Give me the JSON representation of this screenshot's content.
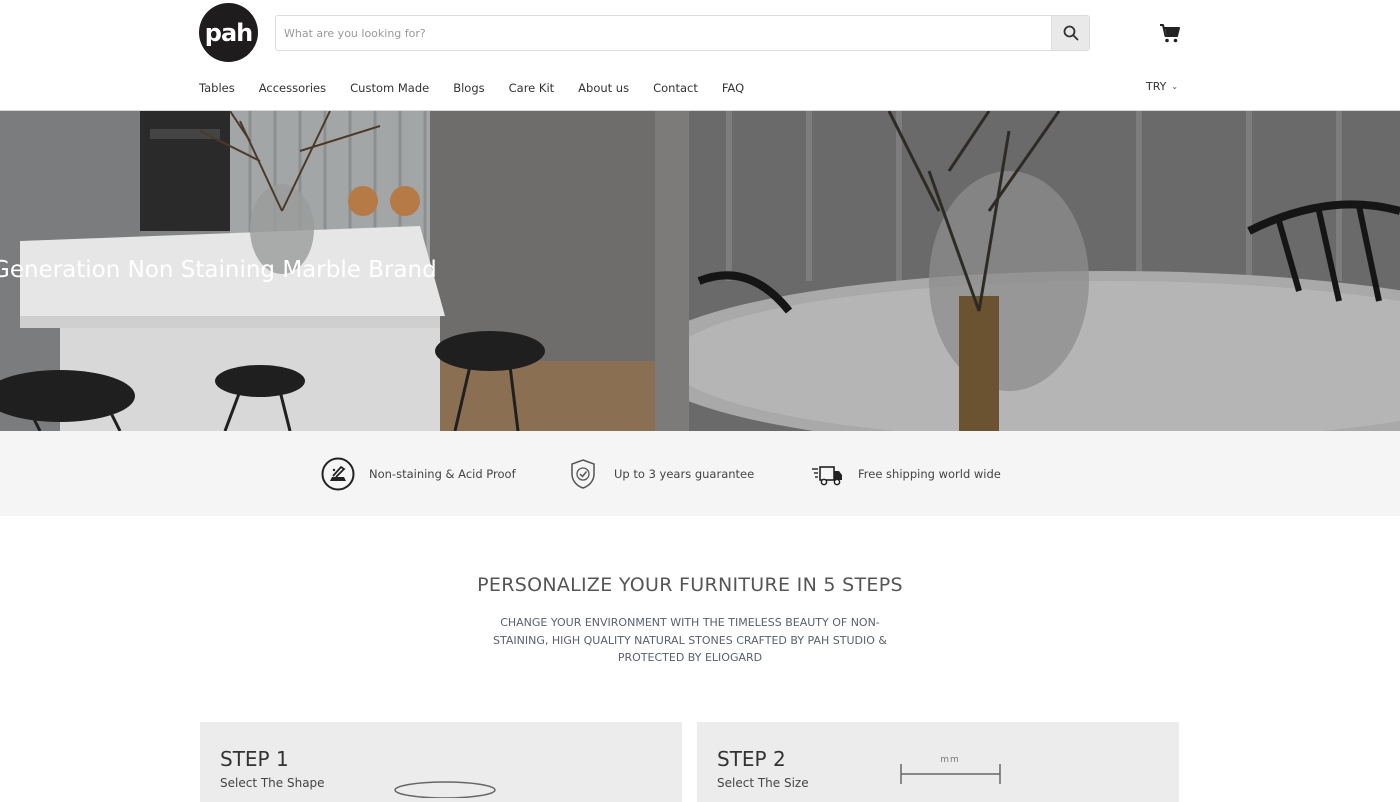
{
  "header": {
    "logo_text": "pah",
    "search": {
      "placeholder": "What are you looking for?"
    },
    "nav": [
      "Tables",
      "Accessories",
      "Custom Made",
      "Blogs",
      "Care Kit",
      "About us",
      "Contact",
      "FAQ"
    ],
    "currency": "TRY"
  },
  "hero": {
    "title": "Generation Non Staining Marble Brand"
  },
  "features": [
    {
      "icon": "acid-proof-icon",
      "label": "Non-staining & Acid Proof"
    },
    {
      "icon": "shield-icon",
      "label": "Up to 3 years guarantee"
    },
    {
      "icon": "truck-icon",
      "label": "Free shipping world wide"
    }
  ],
  "steps_section": {
    "title": "PERSONALIZE YOUR FURNITURE IN 5 STEPS",
    "subtitle": "CHANGE YOUR ENVIRONMENT WITH THE TIMELESS BEAUTY OF NON-STAINING, HIGH QUALITY NATURAL STONES CRAFTED BY PAH STUDIO & PROTECTED BY ELIOGARD",
    "steps": [
      {
        "number": "STEP 1",
        "label": "Select The Shape"
      },
      {
        "number": "STEP 2",
        "label": "Select The Size",
        "unit": "mm"
      }
    ]
  }
}
